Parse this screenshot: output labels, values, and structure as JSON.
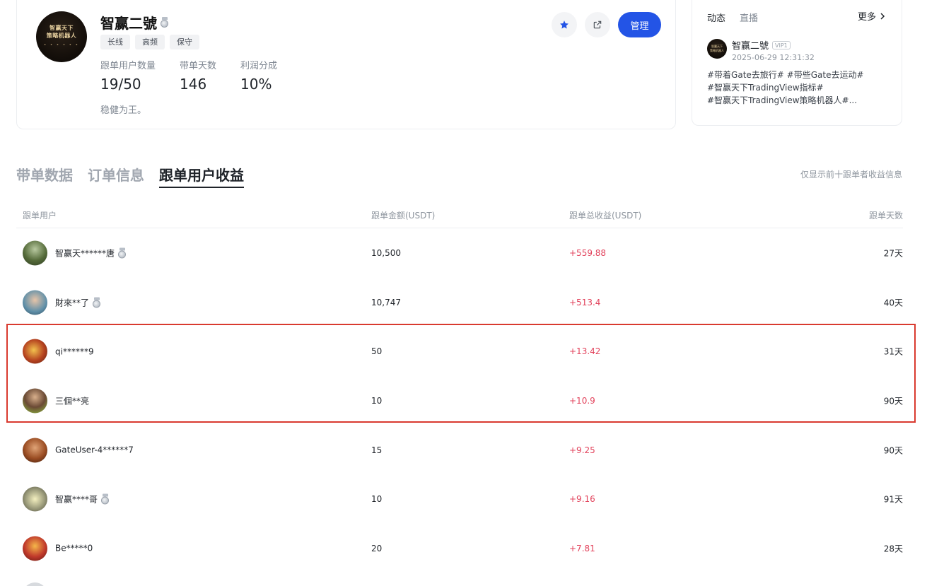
{
  "profile": {
    "avatar_text": [
      "智赢天下",
      "策略机器人"
    ],
    "avatar_dots": "• • • • • •",
    "name": "智赢二號",
    "tags": [
      "长线",
      "高频",
      "保守"
    ],
    "stats": [
      {
        "label": "跟单用户数量",
        "value": "19/50"
      },
      {
        "label": "带单天数",
        "value": "146"
      },
      {
        "label": "利润分成",
        "value": "10%"
      }
    ],
    "description": "稳健为王。",
    "manage_label": "管理",
    "icons": [
      "star-icon",
      "share-icon"
    ],
    "accent_color": "#2354e6"
  },
  "feed": {
    "tabs": [
      "动态",
      "直播"
    ],
    "more_label": "更多",
    "post": {
      "user": "智赢二號",
      "badge": "VIP1",
      "time": "2025-06-29 12:31:32",
      "text": [
        "#带着Gate去旅行# #带些Gate去运动#",
        "#智赢天下TradingView指标#",
        "#智赢天下TradingView策略机器人#..."
      ]
    }
  },
  "main_tabs": [
    "带单数据",
    "订单信息",
    "跟单用户收益"
  ],
  "tab_note": "仅显示前十跟单者收益信息",
  "table": {
    "headers": [
      "跟单用户",
      "跟单金额(USDT)",
      "跟单总收益(USDT)",
      "跟单天数"
    ],
    "rows": [
      {
        "user": "智赢天******唐",
        "medal": true,
        "amount": "10,500",
        "profit": "+559.88",
        "days": "27天"
      },
      {
        "user": "財來**了",
        "medal": true,
        "amount": "10,747",
        "profit": "+513.4",
        "days": "40天"
      },
      {
        "user": "qi******9",
        "medal": false,
        "amount": "50",
        "profit": "+13.42",
        "days": "31天"
      },
      {
        "user": "三個**亮",
        "medal": false,
        "amount": "10",
        "profit": "+10.9",
        "days": "90天"
      },
      {
        "user": "GateUser-4******7",
        "medal": false,
        "amount": "15",
        "profit": "+9.25",
        "days": "90天"
      },
      {
        "user": "智赢****哥",
        "medal": true,
        "amount": "10",
        "profit": "+9.16",
        "days": "91天"
      },
      {
        "user": "Be*****0",
        "medal": false,
        "amount": "20",
        "profit": "+7.81",
        "days": "28天"
      }
    ],
    "profit_color": "#e2435c",
    "highlight_color": "#d93a2f"
  }
}
